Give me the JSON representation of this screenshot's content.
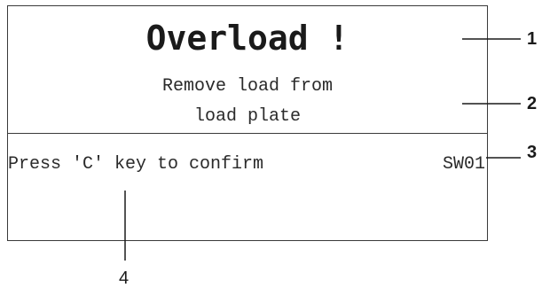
{
  "display": {
    "title": "Overload !",
    "message_line_1": "Remove load from",
    "message_line_2": "load plate",
    "instruction": "Press 'C' key to confirm",
    "screen_id": "SW01"
  },
  "callouts": [
    "1",
    "2",
    "3",
    "4"
  ]
}
